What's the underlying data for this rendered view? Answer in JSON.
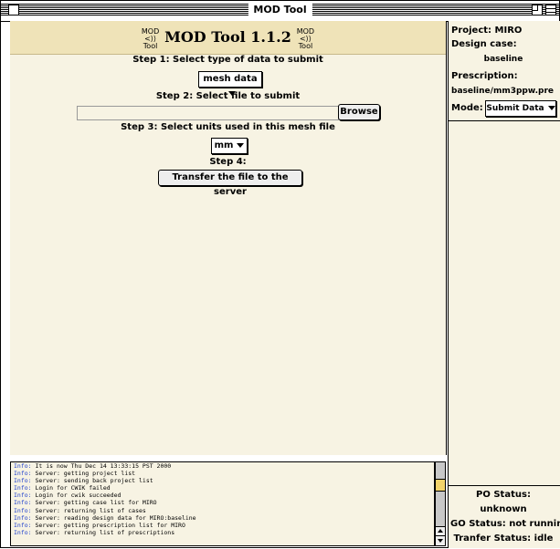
{
  "window": {
    "title": "MOD Tool"
  },
  "header": {
    "title": "MOD Tool 1.1.2",
    "logo_top": "MOD",
    "logo_bottom": "Tool"
  },
  "steps": {
    "step1_label": "Step 1: Select type of data to submit",
    "step1_value": "mesh data",
    "step2_label": "Step 2: Select file to submit",
    "browse_label": "Browse",
    "step3_label": "Step 3: Select units used in this mesh file",
    "step3_value": "mm",
    "step4_label": "Step 4:",
    "transfer_label": "Transfer the file to the server"
  },
  "sidebar": {
    "project_label": "Project: MIRO",
    "design_case_label": "Design case:",
    "design_case_value": "baseline",
    "prescription_label": "Prescription:",
    "prescription_value": "baseline/mm3ppw.pre",
    "mode_label": "Mode:",
    "mode_value": "Submit Data",
    "po_status_label": "PO Status:",
    "po_status_value": "unknown",
    "go_status": "GO Status: not running",
    "transfer_status": "Tranfer Status: idle"
  },
  "log": [
    {
      "tag": "Info:",
      "text": "It is now Thu Dec 14 13:33:15 PST 2000"
    },
    {
      "tag": "Info:",
      "text": "Server: getting project list"
    },
    {
      "tag": "Info:",
      "text": "Server: sending back project list"
    },
    {
      "tag": "Info:",
      "text": "Login for CWIK failed"
    },
    {
      "tag": "Info:",
      "text": "Login for cwik succeeded"
    },
    {
      "tag": "Info:",
      "text": "Server: getting case list for MIRO"
    },
    {
      "tag": "Info:",
      "text": "Server: returning list of cases"
    },
    {
      "tag": "Info:",
      "text": "Server: reading design data for MIRO:baseline"
    },
    {
      "tag": "Info:",
      "text": "Server: getting prescription list for MIRO"
    },
    {
      "tag": "Info:",
      "text": "Server: returning list of prescriptions"
    }
  ]
}
